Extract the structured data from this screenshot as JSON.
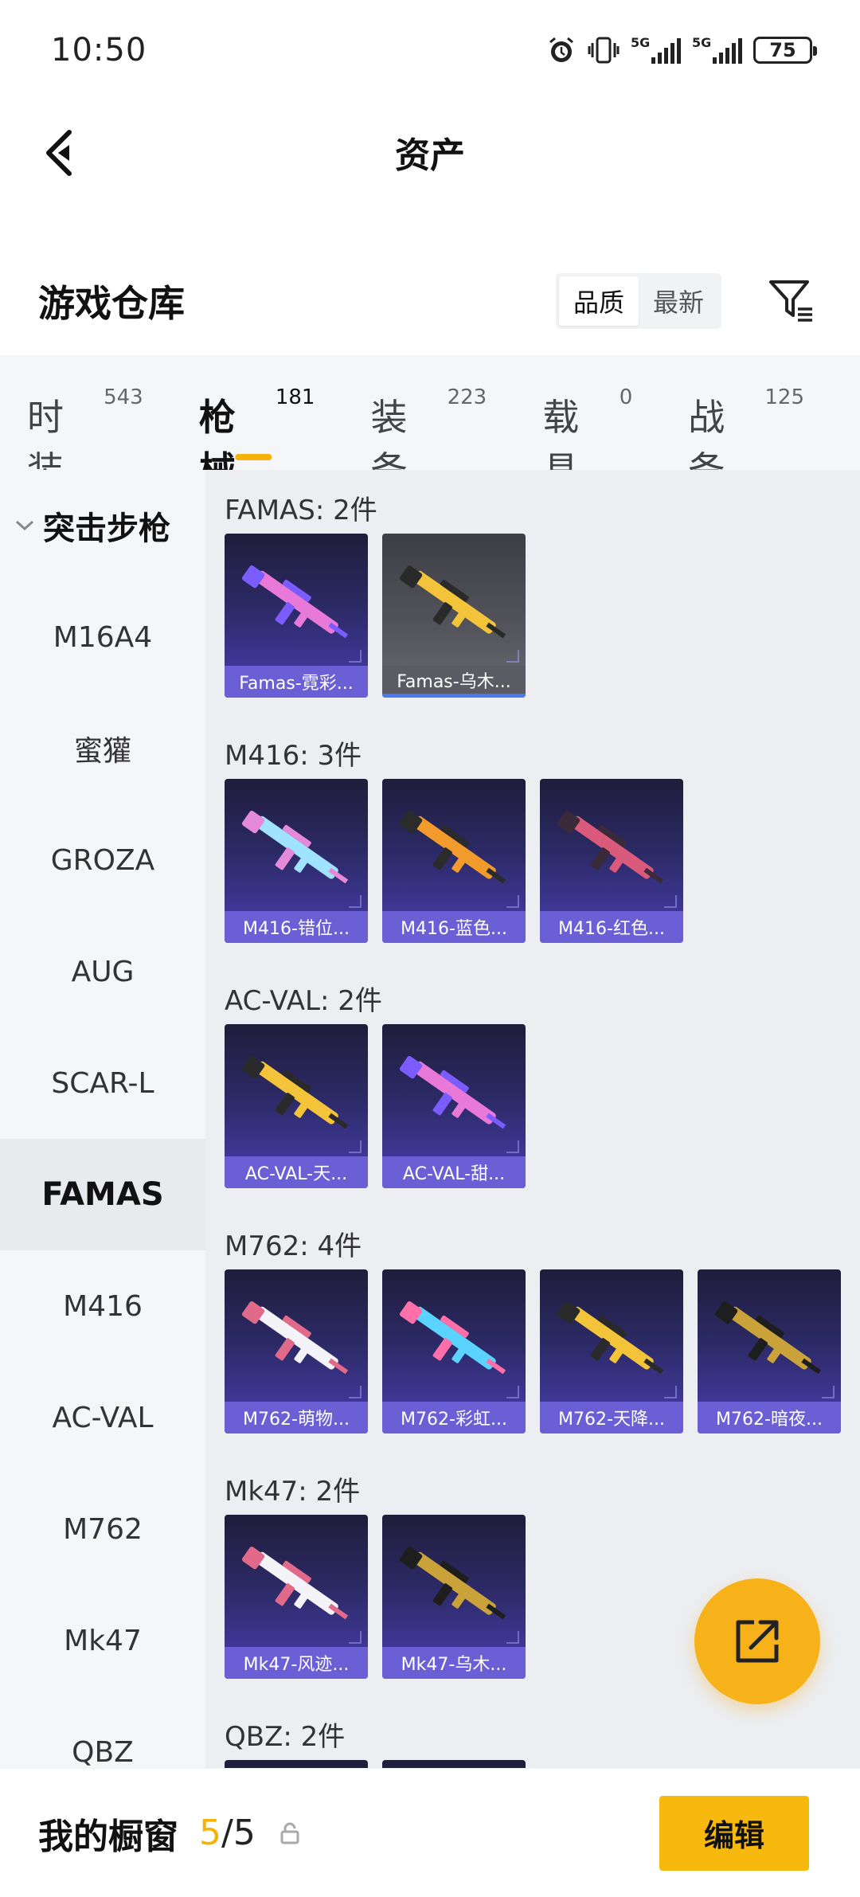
{
  "status": {
    "time": "10:50",
    "battery": "75",
    "signal_1": "5G",
    "signal_2": "5G"
  },
  "header": {
    "title": "资产"
  },
  "warehouse": {
    "title": "游戏仓库",
    "sort_options": [
      "品质",
      "最新"
    ]
  },
  "category_tabs": [
    {
      "label": "时装",
      "count": "543"
    },
    {
      "label": "枪械",
      "count": "181"
    },
    {
      "label": "装备",
      "count": "223"
    },
    {
      "label": "载具",
      "count": "0"
    },
    {
      "label": "战备",
      "count": "125"
    }
  ],
  "sidebar": {
    "group_label": "突击步枪",
    "items": [
      "M16A4",
      "蜜獾",
      "GROZA",
      "AUG",
      "SCAR-L",
      "FAMAS",
      "M416",
      "AC-VAL",
      "M762",
      "Mk47",
      "QBZ"
    ]
  },
  "groups": [
    {
      "title": "FAMAS: 2件",
      "cards": [
        {
          "name": "Famas-霓彩...",
          "style": "purple",
          "gun": "pink"
        },
        {
          "name": "Famas-乌木...",
          "style": "gray",
          "gun": "gold"
        }
      ]
    },
    {
      "title": "M416: 3件",
      "cards": [
        {
          "name": "M416-错位...",
          "style": "purple",
          "gun": "cyan"
        },
        {
          "name": "M416-蓝色...",
          "style": "purple",
          "gun": "orange"
        },
        {
          "name": "M416-红色...",
          "style": "purple",
          "gun": "red"
        }
      ]
    },
    {
      "title": "AC-VAL: 2件",
      "cards": [
        {
          "name": "AC-VAL-天...",
          "style": "purple",
          "gun": "gold"
        },
        {
          "name": "AC-VAL-甜...",
          "style": "purple",
          "gun": "pink"
        }
      ]
    },
    {
      "title": "M762: 4件",
      "cards": [
        {
          "name": "M762-萌物...",
          "style": "purple",
          "gun": "white"
        },
        {
          "name": "M762-彩虹...",
          "style": "purple",
          "gun": "rainbow"
        },
        {
          "name": "M762-天降...",
          "style": "purple",
          "gun": "gold"
        },
        {
          "name": "M762-暗夜...",
          "style": "purple",
          "gun": "darkgold"
        }
      ]
    },
    {
      "title": "Mk47: 2件",
      "cards": [
        {
          "name": "Mk47-风迹...",
          "style": "purple",
          "gun": "white"
        },
        {
          "name": "Mk47-乌木...",
          "style": "purple",
          "gun": "darkgold"
        }
      ]
    },
    {
      "title": "QBZ: 2件",
      "cards": [
        {
          "name": "",
          "style": "purple",
          "gun": "none"
        },
        {
          "name": "",
          "style": "purple",
          "gun": "none"
        }
      ]
    }
  ],
  "bottom_bar": {
    "title": "我的橱窗",
    "current": "5",
    "total": "/5",
    "edit_label": "编辑"
  },
  "colors": {
    "accent": "#f5b30a",
    "card_purple": "#4a3db0",
    "card_label": "#6b5fd6",
    "sidebar_bg": "#f5f6f8",
    "content_bg": "#eceef2"
  },
  "icons": [
    "back-arrow-icon",
    "filter-icon",
    "share-icon",
    "lock-icon",
    "chevron-down-icon",
    "alarm-icon",
    "vibrate-icon"
  ]
}
